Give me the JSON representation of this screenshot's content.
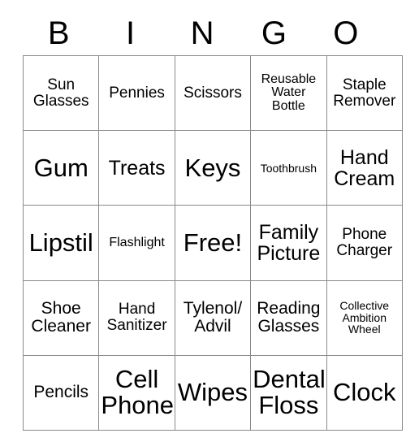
{
  "card": {
    "title_letters": [
      "B",
      "I",
      "N",
      "G",
      "O"
    ],
    "free_space": "Free!",
    "colors": {
      "background": "#ffffff",
      "text": "#000000",
      "grid_line": "#8a8a8a"
    },
    "rows": [
      [
        {
          "label": "Sun\nGlasses",
          "size": "md"
        },
        {
          "label": "Pennies",
          "size": "md"
        },
        {
          "label": "Scissors",
          "size": "md"
        },
        {
          "label": "Reusable\nWater\nBottle",
          "size": "sm"
        },
        {
          "label": "Staple\nRemover",
          "size": "md"
        }
      ],
      [
        {
          "label": "Gum",
          "size": "xxl"
        },
        {
          "label": "Treats",
          "size": "xl"
        },
        {
          "label": "Keys",
          "size": "xxl"
        },
        {
          "label": "Toothbrush",
          "size": "xs"
        },
        {
          "label": "Hand\nCream",
          "size": "xl"
        }
      ],
      [
        {
          "label": "Lipstil",
          "size": "xxl",
          "clip": true
        },
        {
          "label": "Flashlight",
          "size": "sm"
        },
        {
          "label": "Free!",
          "size": "xxl"
        },
        {
          "label": "Family\nPicture",
          "size": "xl"
        },
        {
          "label": "Phone\nCharger",
          "size": "md"
        }
      ],
      [
        {
          "label": "Shoe\nCleaner",
          "size": "lg"
        },
        {
          "label": "Hand\nSanitizer",
          "size": "md"
        },
        {
          "label": "Tylenol/\nAdvil",
          "size": "lg"
        },
        {
          "label": "Reading\nGlasses",
          "size": "lg"
        },
        {
          "label": "Collective\nAmbition\nWheel",
          "size": "xs"
        }
      ],
      [
        {
          "label": "Pencils",
          "size": "lg"
        },
        {
          "label": "Cell\nPhone",
          "size": "xxl"
        },
        {
          "label": "Wipes",
          "size": "xxl"
        },
        {
          "label": "Dental\nFloss",
          "size": "xxl"
        },
        {
          "label": "Clock",
          "size": "xxl"
        }
      ]
    ]
  }
}
